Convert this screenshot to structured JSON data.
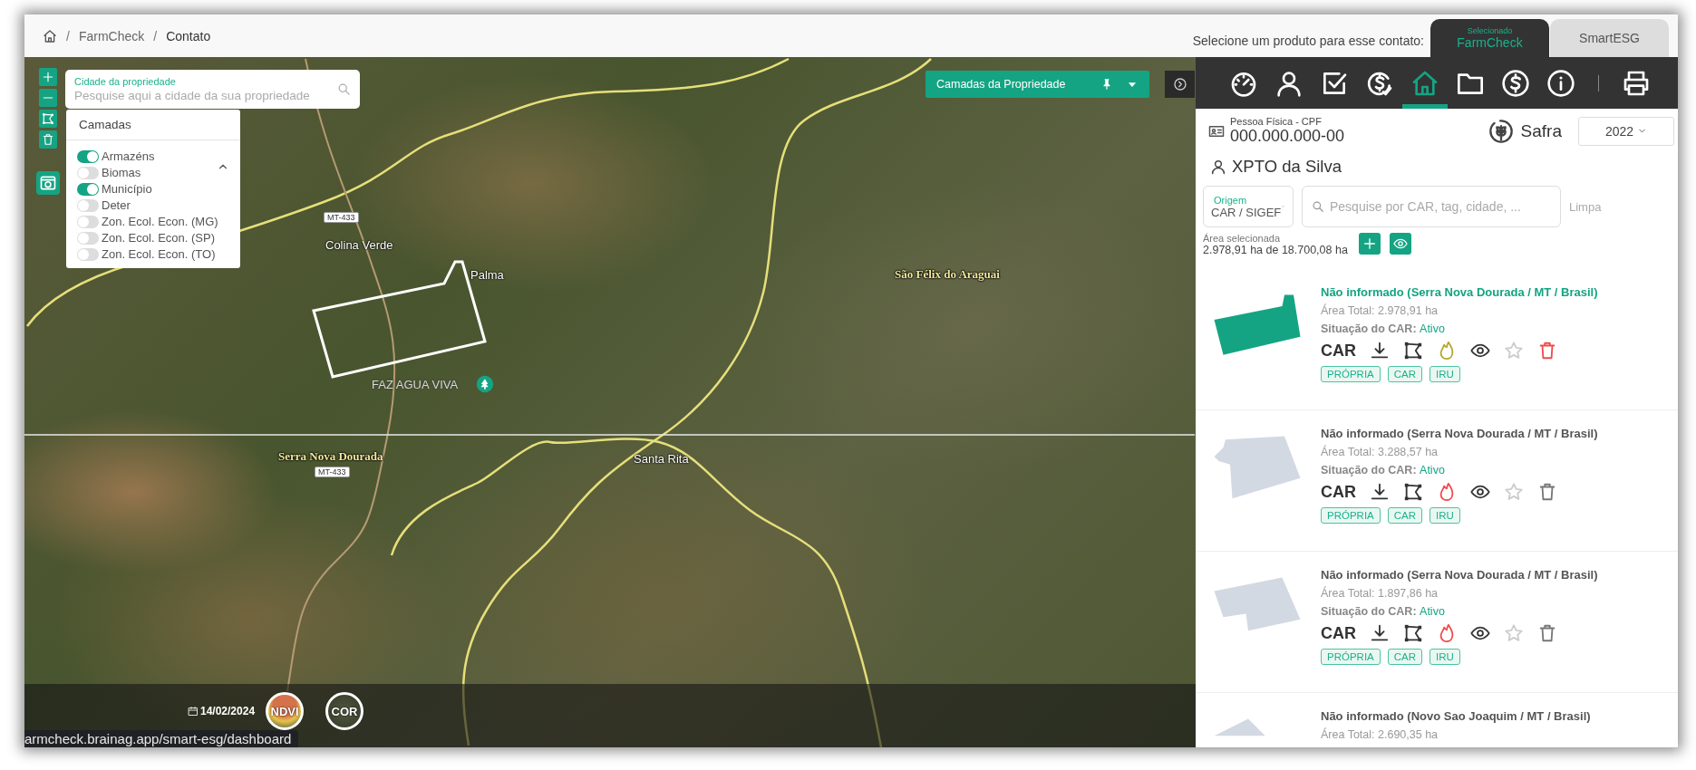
{
  "breadcrumb": {
    "separator": "/",
    "items": [
      "FarmCheck",
      "Contato"
    ]
  },
  "product_selector": {
    "label": "Selecione um produto para esse contato:",
    "tabs": [
      {
        "caption": "Selecionado",
        "label": "FarmCheck",
        "selected": true
      },
      {
        "label": "SmartESG",
        "selected": false
      }
    ]
  },
  "map": {
    "search": {
      "label": "Cidade da propriedade",
      "placeholder": "Pesquise aqui a cidade da sua propriedade"
    },
    "layers": {
      "title": "Camadas",
      "items": [
        {
          "label": "Armazéns",
          "on": true
        },
        {
          "label": "Biomas",
          "on": false
        },
        {
          "label": "Município",
          "on": true
        },
        {
          "label": "Deter",
          "on": false
        },
        {
          "label": "Zon. Ecol. Econ. (MG)",
          "on": false
        },
        {
          "label": "Zon. Ecol. Econ. (SP)",
          "on": false
        },
        {
          "label": "Zon. Ecol. Econ. (TO)",
          "on": false
        }
      ]
    },
    "layers_button": {
      "label": "Camadas da Propriedade"
    },
    "labels": [
      {
        "text": "MT-433",
        "kind": "shield"
      },
      {
        "text": "Colina Verde",
        "kind": "place"
      },
      {
        "text": "Palma",
        "kind": "place"
      },
      {
        "text": "São Félix do Araguai",
        "kind": "city"
      },
      {
        "text": "FAZ AGUA VIVA",
        "kind": "farm"
      },
      {
        "text": "Serra Nova Dourada",
        "kind": "city"
      },
      {
        "text": "MT-433",
        "kind": "shield"
      },
      {
        "text": "Santa Rita",
        "kind": "place"
      }
    ],
    "imagery_bar": {
      "date": "14/02/2024",
      "modes": [
        {
          "label": "NDVI",
          "kind": "ndvi"
        },
        {
          "label": "COR",
          "kind": "color"
        }
      ]
    }
  },
  "panel": {
    "toolbar": [
      {
        "selected": false
      },
      {
        "selected": false
      },
      {
        "selected": false
      },
      {
        "selected": false
      },
      {
        "selected": true
      },
      {
        "selected": false
      },
      {
        "selected": false
      },
      {
        "selected": false
      }
    ],
    "person": {
      "type_label": "Pessoa Física - CPF",
      "document": "000.000.000-00",
      "name": "XPTO da Silva"
    },
    "safra": {
      "label": "Safra",
      "value": "2022"
    },
    "filters": {
      "origin": {
        "label": "Origem",
        "value": "CAR / SIGEF"
      },
      "search": {
        "placeholder": "Pesquise por CAR, tag, cidade, ..."
      },
      "clear": "Limpa"
    },
    "selected_area": {
      "label": "Área selecionada",
      "value": "2.978,91 ha de 18.700,08 ha"
    },
    "properties": [
      {
        "title": "Não informado (Serra Nova Dourada / MT / Brasil)",
        "area": "Área Total: 2.978,91 ha",
        "status_label": "Situação do CAR:",
        "status": "Ativo",
        "code": "CAR",
        "color": "#b3a62c",
        "selected": true,
        "tags": [
          "PRÓPRIA",
          "CAR",
          "IRU"
        ]
      },
      {
        "title": "Não informado (Serra Nova Dourada / MT / Brasil)",
        "area": "Área Total: 3.288,57 ha",
        "status_label": "Situação do CAR:",
        "status": "Ativo",
        "code": "CAR",
        "color": "#f04a4a",
        "selected": false,
        "tags": [
          "PRÓPRIA",
          "CAR",
          "IRU"
        ]
      },
      {
        "title": "Não informado (Serra Nova Dourada / MT / Brasil)",
        "area": "Área Total: 1.897,86 ha",
        "status_label": "Situação do CAR:",
        "status": "Ativo",
        "code": "CAR",
        "color": "#f04a4a",
        "selected": false,
        "tags": [
          "PRÓPRIA",
          "CAR",
          "IRU"
        ]
      },
      {
        "title": "Não informado (Novo Sao Joaquim / MT / Brasil)",
        "area": "Área Total: 2.690,35 ha",
        "selected": false
      }
    ]
  },
  "status_url": "armcheck.brainag.app/smart-esg/dashboard"
}
